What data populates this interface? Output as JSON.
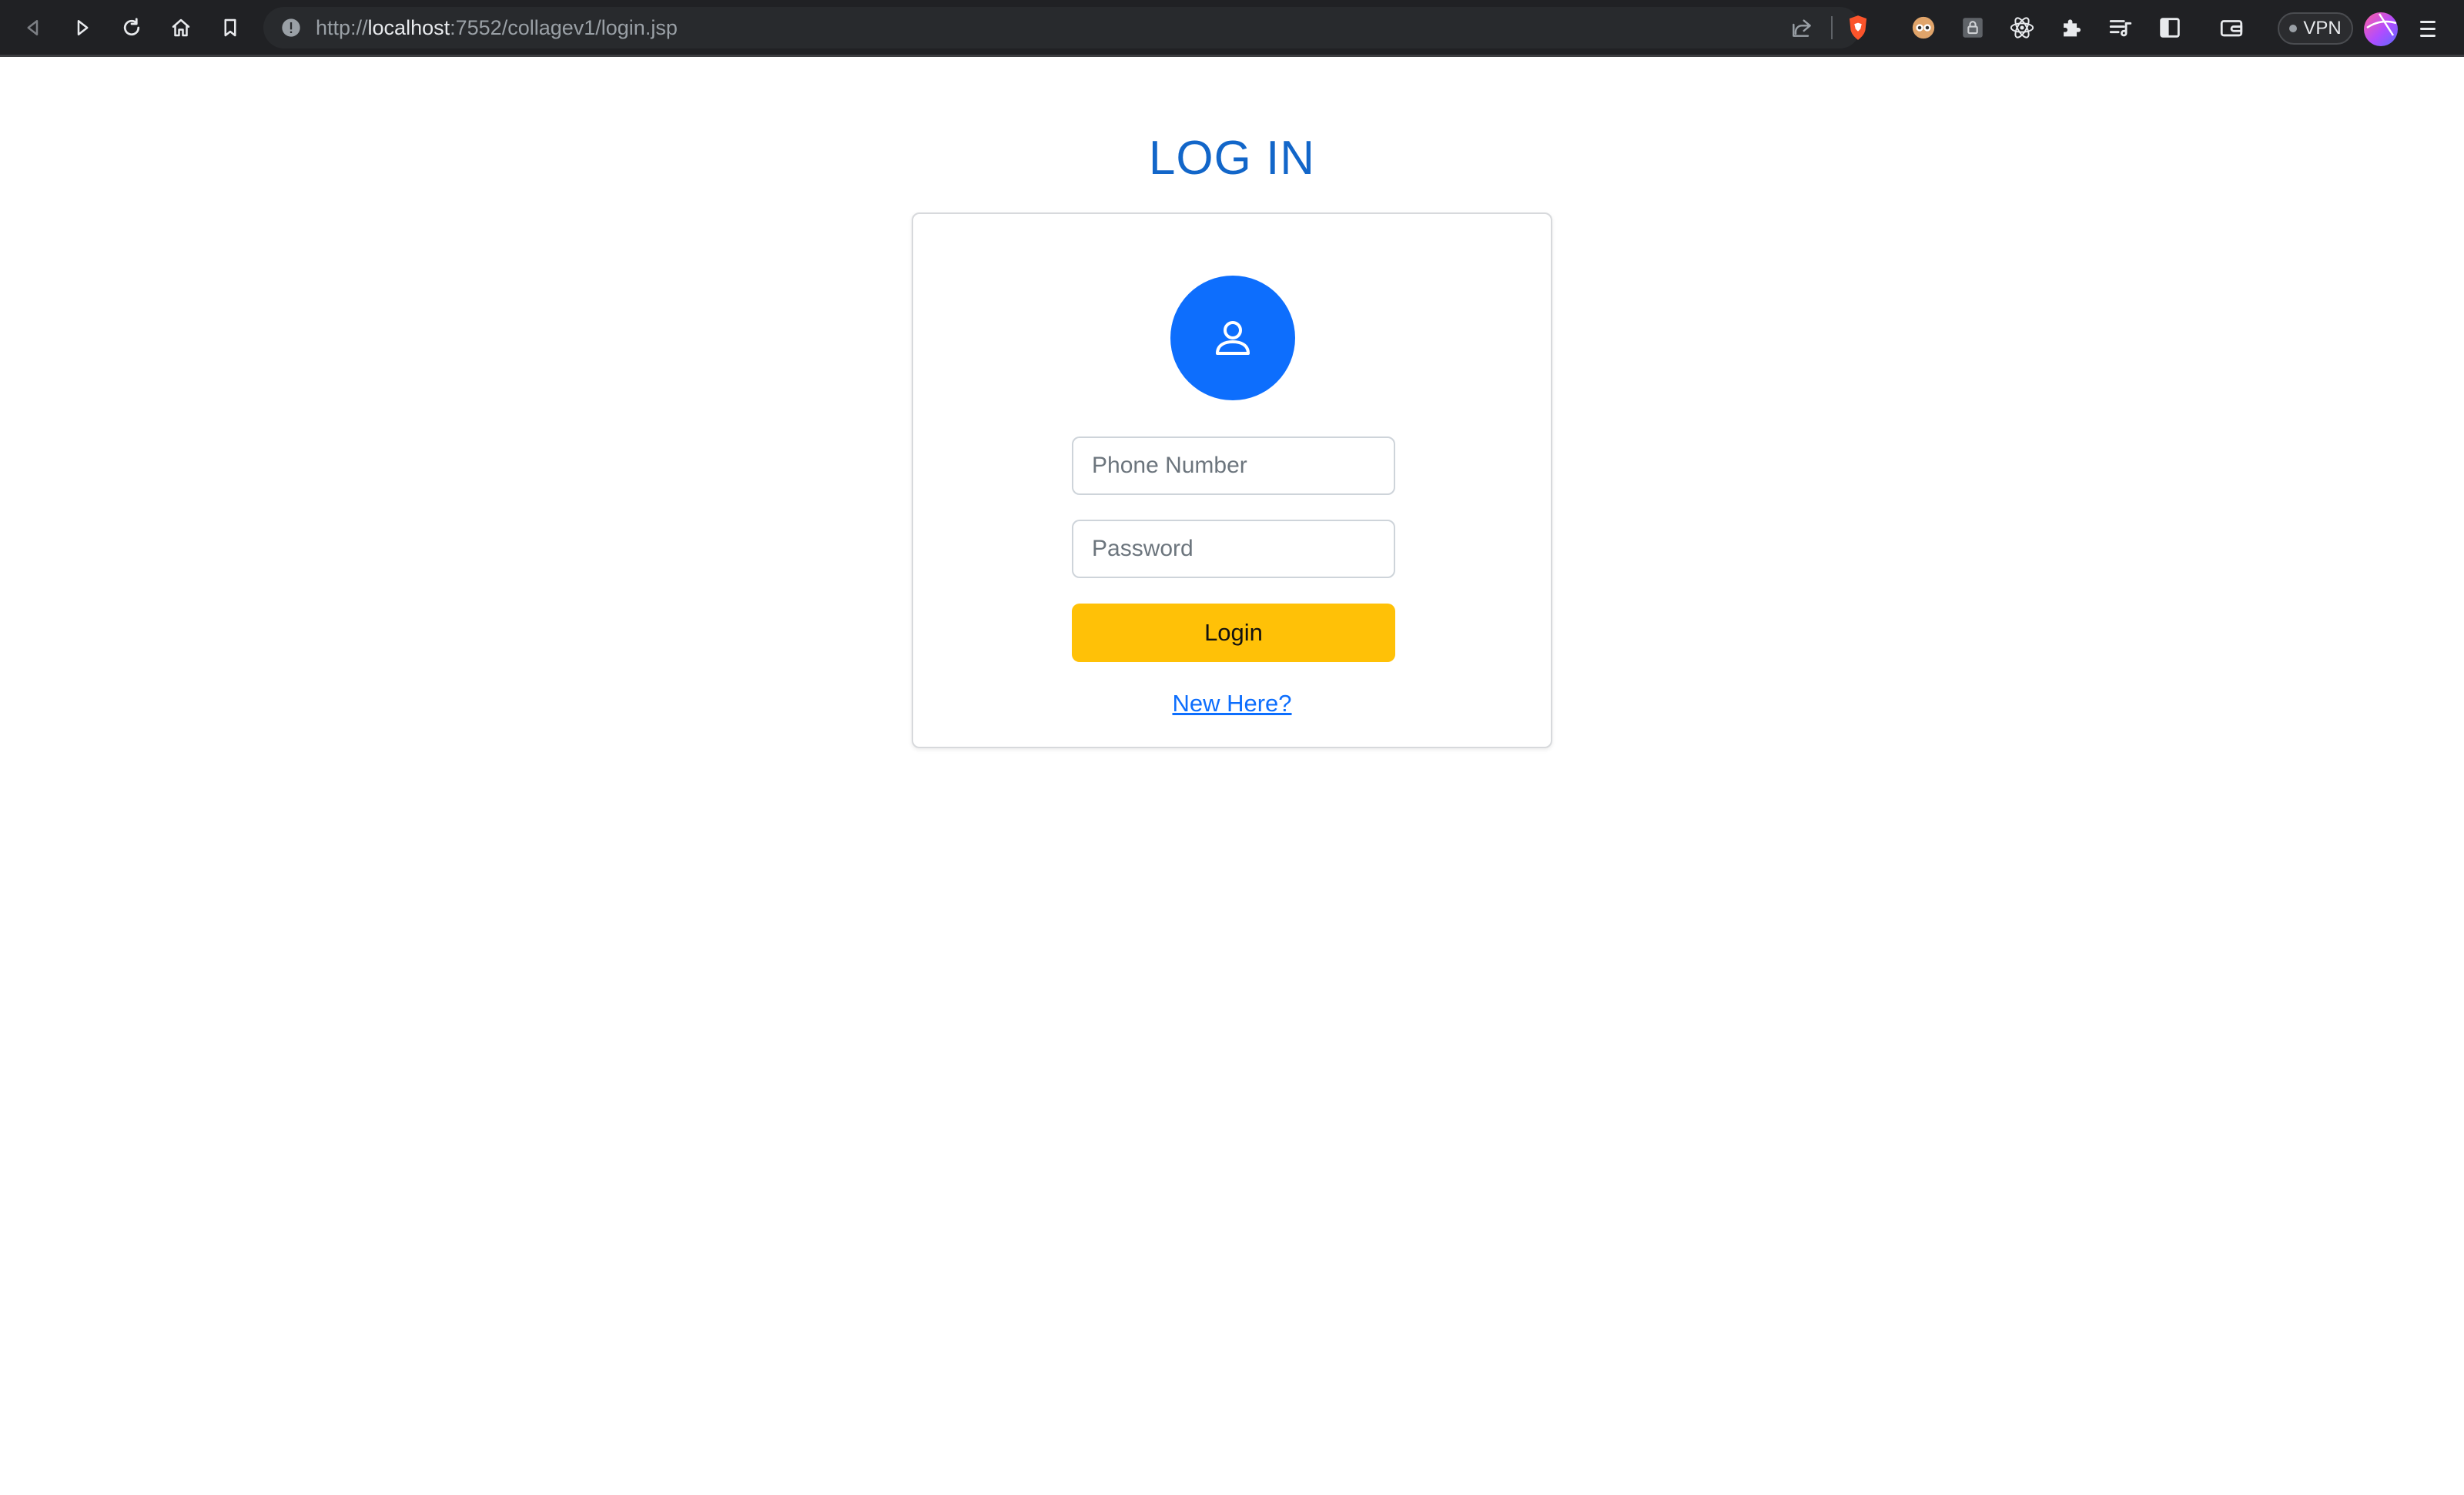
{
  "browser": {
    "url_scheme": "http://",
    "url_host": "localhost",
    "url_path": ":7552/collagev1/login.jsp",
    "vpn_label": "VPN"
  },
  "page": {
    "title": "LOG IN",
    "phone_placeholder": "Phone Number",
    "phone_value": "",
    "password_placeholder": "Password",
    "password_value": "",
    "login_label": "Login",
    "signup_link": "New Here?"
  },
  "colors": {
    "title": "#1266c9",
    "avatar": "#0d6efd",
    "login_button": "#ffc107",
    "link": "#0d6efd"
  },
  "icons": {
    "avatar": "person-icon"
  }
}
